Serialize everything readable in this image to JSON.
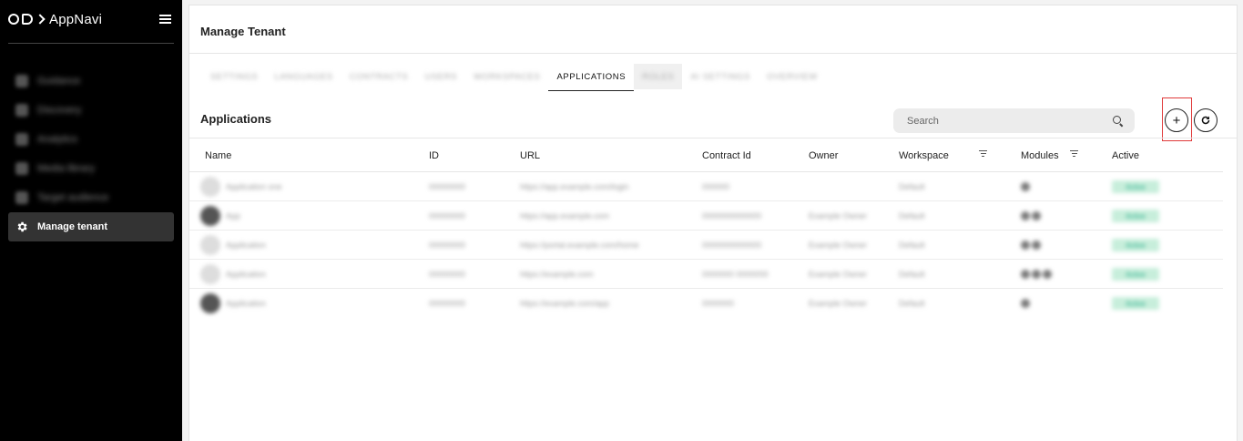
{
  "app": {
    "name": "AppNavi"
  },
  "sidebar": {
    "items": [
      {
        "label": "Guidance",
        "icon": "guidance-icon",
        "blurred": true
      },
      {
        "label": "Discovery",
        "icon": "discovery-icon",
        "blurred": true
      },
      {
        "label": "Analytics",
        "icon": "analytics-icon",
        "blurred": true
      },
      {
        "label": "Media library",
        "icon": "media-icon",
        "blurred": true
      },
      {
        "label": "Target audience",
        "icon": "target-icon",
        "blurred": true
      },
      {
        "label": "Manage tenant",
        "icon": "gear-icon",
        "active": true
      }
    ]
  },
  "page": {
    "title": "Manage Tenant"
  },
  "tabs": [
    {
      "label": "SETTINGS",
      "blurred": true
    },
    {
      "label": "LANGUAGES",
      "blurred": true
    },
    {
      "label": "CONTRACTS",
      "blurred": true
    },
    {
      "label": "USERS",
      "blurred": true
    },
    {
      "label": "WORKSPACES",
      "blurred": true
    },
    {
      "label": "APPLICATIONS",
      "active": true
    },
    {
      "label": "ROLES",
      "blurred": true,
      "shaded": true
    },
    {
      "label": "AI SETTINGS",
      "blurred": true
    },
    {
      "label": "OVERVIEW",
      "blurred": true
    }
  ],
  "section": {
    "title": "Applications"
  },
  "search": {
    "placeholder": "Search",
    "value": ""
  },
  "table": {
    "columns": {
      "name": "Name",
      "id": "ID",
      "url": "URL",
      "contract": "Contract Id",
      "owner": "Owner",
      "workspace": "Workspace",
      "modules": "Modules",
      "active": "Active"
    },
    "rows": [
      {
        "name": "Application one",
        "id": "00000000",
        "url": "https://app.example.com/login",
        "contract": "000000",
        "owner": "",
        "workspace": "Default",
        "modules": 1,
        "active": "Active",
        "avatar": "light"
      },
      {
        "name": "App",
        "id": "00000000",
        "url": "https://app.example.com",
        "contract": "0000000000000",
        "owner": "Example Owner",
        "workspace": "Default",
        "modules": 2,
        "active": "Active",
        "avatar": "dark"
      },
      {
        "name": "Application",
        "id": "00000000",
        "url": "https://portal.example.com/home",
        "contract": "0000000000000",
        "owner": "Example Owner",
        "workspace": "Default",
        "modules": 2,
        "active": "Active",
        "avatar": "light"
      },
      {
        "name": "Application",
        "id": "00000000",
        "url": "https://example.com",
        "contract": "0000000 0000000",
        "owner": "Example Owner",
        "workspace": "Default",
        "modules": 3,
        "active": "Active",
        "avatar": "light"
      },
      {
        "name": "Application",
        "id": "00000000",
        "url": "https://example.com/app",
        "contract": "0000000",
        "owner": "Example Owner",
        "workspace": "Default",
        "modules": 1,
        "active": "Active",
        "avatar": "dark"
      }
    ]
  }
}
